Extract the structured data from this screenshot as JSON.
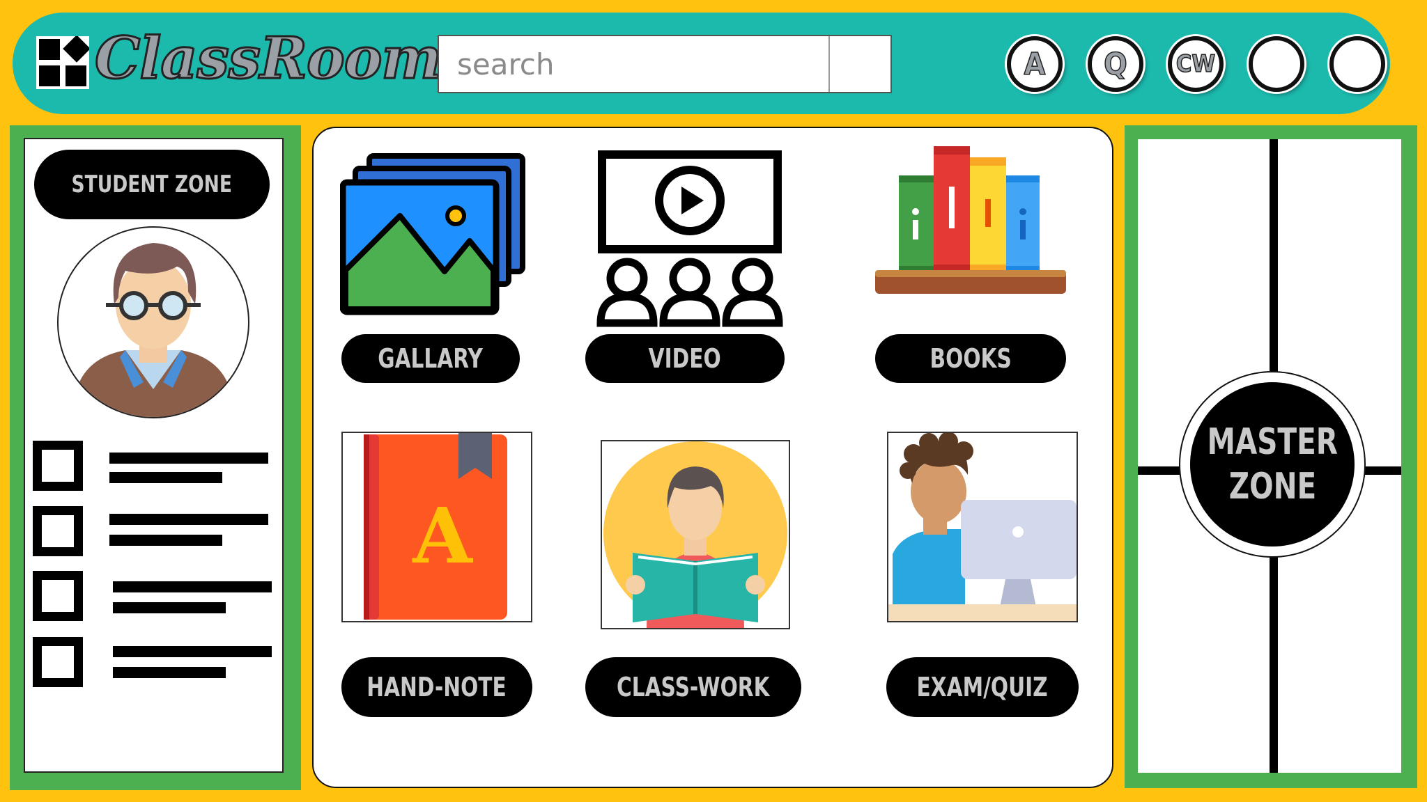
{
  "header": {
    "app_title": "ClassRoom",
    "search": {
      "placeholder": "search"
    },
    "buttons": [
      {
        "label": "A"
      },
      {
        "label": "Q"
      },
      {
        "label": "CW"
      },
      {
        "label": ""
      },
      {
        "label": ""
      }
    ]
  },
  "left": {
    "zone_label": "STUDENT ZONE"
  },
  "center": {
    "tiles": [
      {
        "label": "GALLARY",
        "icon": "gallery-icon"
      },
      {
        "label": "VIDEO",
        "icon": "video-class-icon"
      },
      {
        "label": "BOOKS",
        "icon": "books-icon"
      },
      {
        "label": "HAND-NOTE",
        "icon": "notebook-icon"
      },
      {
        "label": "CLASS-WORK",
        "icon": "reading-student-icon"
      },
      {
        "label": "EXAM/QUIZ",
        "icon": "computer-student-icon"
      }
    ]
  },
  "right": {
    "zone_label_line1": "MASTER",
    "zone_label_line2": "ZONE"
  },
  "colors": {
    "background": "#FFC20E",
    "header": "#1CB9AD",
    "panel_green": "#4CAF50",
    "pill_black": "#000000"
  }
}
